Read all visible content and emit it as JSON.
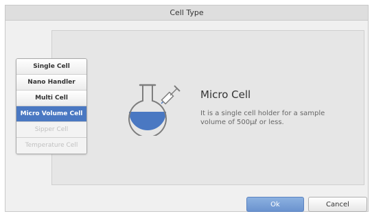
{
  "dialog": {
    "title": "Cell Type",
    "cell_types": [
      {
        "label": "Single Cell",
        "state": "normal"
      },
      {
        "label": "Nano Handler",
        "state": "normal"
      },
      {
        "label": "Multi Cell",
        "state": "normal"
      },
      {
        "label": "Micro Volume Cell",
        "state": "selected"
      },
      {
        "label": "Sipper Cell",
        "state": "disabled"
      },
      {
        "label": "Temperature Cell",
        "state": "disabled"
      }
    ],
    "detail": {
      "icon": "flask-with-syringe-icon",
      "title": "Micro Cell",
      "description": "It is a single cell holder for a sample volume of 500μℓ or less."
    },
    "buttons": {
      "ok": "Ok",
      "cancel": "Cancel"
    },
    "colors": {
      "selected": "#4a78c2",
      "liquid": "#4a78c2",
      "ok_button": "#7aa0d8"
    }
  }
}
